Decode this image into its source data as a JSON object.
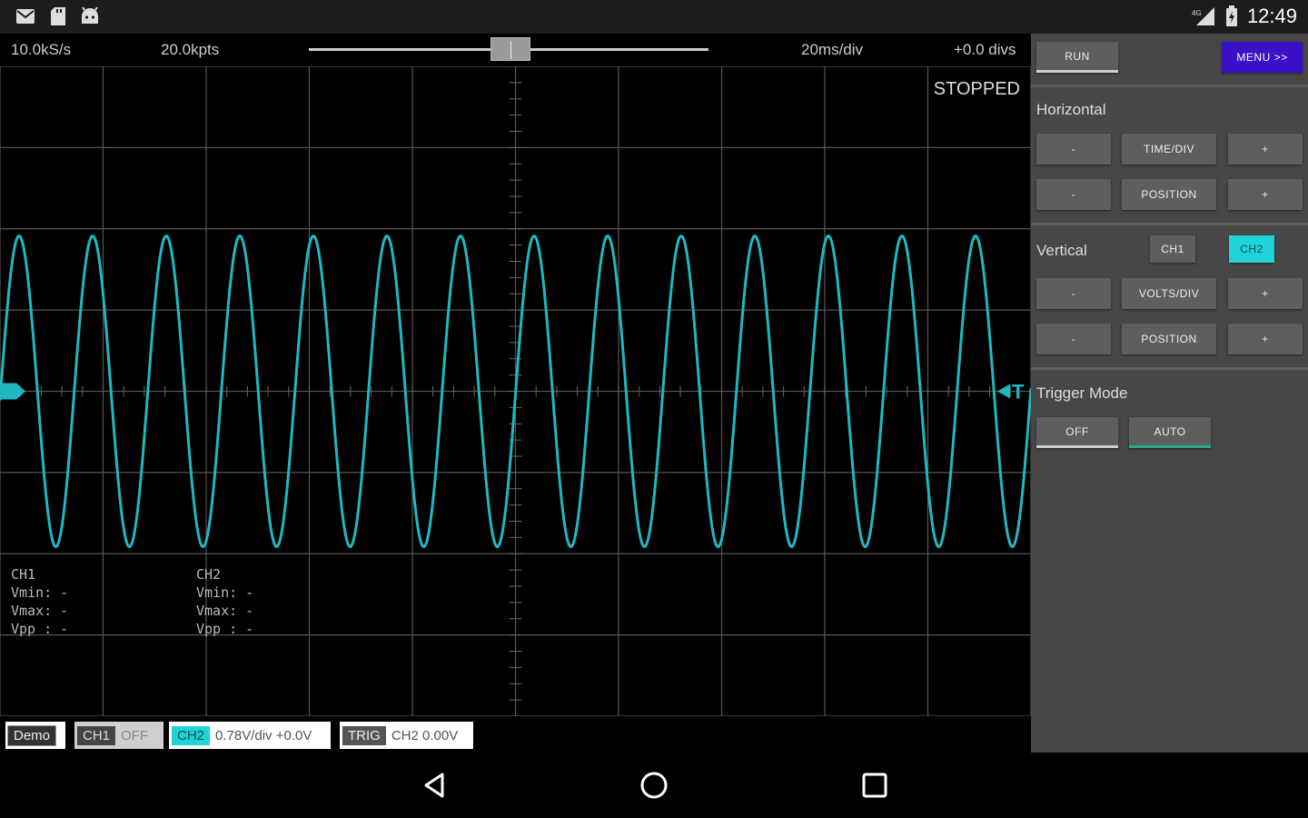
{
  "status_bar": {
    "time": "12:49",
    "left_icons": [
      "mail-icon",
      "sd-card-icon",
      "android-icon"
    ],
    "right_icons": [
      "signal-icon",
      "battery-icon"
    ]
  },
  "topbar": {
    "sample_rate": "10.0kS/s",
    "points": "20.0kpts",
    "time_div": "20ms/div",
    "position": "+0.0 divs"
  },
  "scope": {
    "state": "STOPPED",
    "trigger_marker": "T",
    "trace_color": "#1fb8c0",
    "ch1": {
      "title": "CH1",
      "vmin": "Vmin: -",
      "vmax": "Vmax: -",
      "vpp": "Vpp : -"
    },
    "ch2": {
      "title": "CH2",
      "vmin": "Vmin: -",
      "vmax": "Vmax: -",
      "vpp": "Vpp : -"
    }
  },
  "bottom_strip": {
    "demo": "Demo",
    "ch1_label": "CH1",
    "ch1_value": "OFF",
    "ch2_label": "CH2",
    "ch2_value": "0.78V/div  +0.0V",
    "trig_label": "TRIG",
    "trig_value": "CH2  0.00V"
  },
  "panel": {
    "run": "RUN",
    "menu": "MENU >>",
    "horizontal_title": "Horizontal",
    "time_div_label": "TIME/DIV",
    "h_position_label": "POSITION",
    "vertical_title": "Vertical",
    "ch1": "CH1",
    "ch2": "CH2",
    "volts_div_label": "VOLTS/DIV",
    "v_position_label": "POSITION",
    "minus": "-",
    "plus": "+",
    "trigger_title": "Trigger Mode",
    "trig_off": "OFF",
    "trig_auto": "AUTO",
    "accent_color": "#1fd3d6",
    "menu_color": "#3a10c8"
  }
}
